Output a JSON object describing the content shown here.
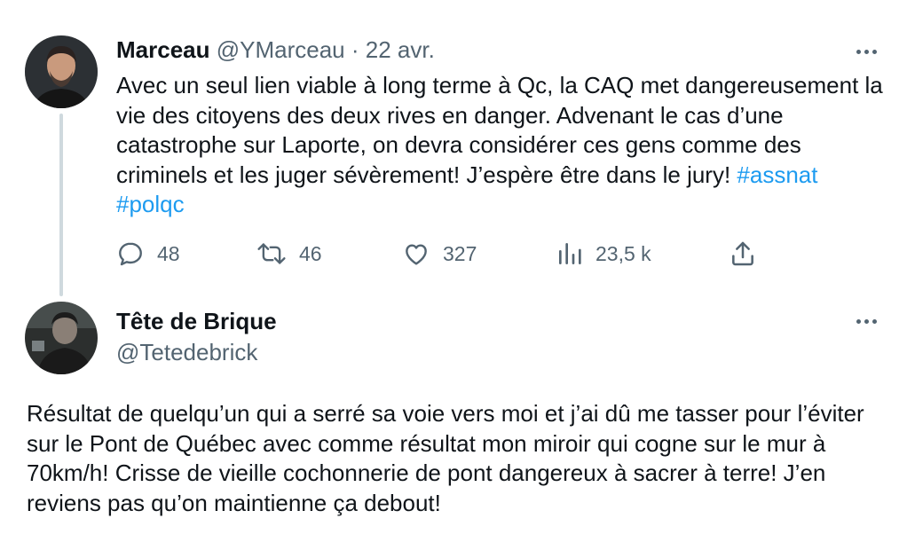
{
  "tweets": [
    {
      "display_name": "Marceau",
      "handle": "@YMarceau",
      "separator": "·",
      "date": "22 avr.",
      "text": "Avec un seul lien viable à long terme à Qc, la CAQ met dangereusement la vie des citoyens des deux rives en danger. Advenant le cas d’une catastrophe sur Laporte, on devra considérer ces gens comme des criminels et les juger sévèrement! J’espère être dans le jury! ",
      "hashtags": [
        "#assnat",
        "#polqc"
      ],
      "stats": {
        "replies": "48",
        "retweets": "46",
        "likes": "327",
        "views": "23,5 k"
      }
    },
    {
      "display_name": "Tête de Brique",
      "handle": "@Tetedebrick",
      "text": "Résultat de quelqu’un qui a serré sa voie vers moi et j’ai dû me tasser pour l’éviter sur le Pont de Québec avec comme résultat mon miroir qui cogne sur le mur à 70km/h! Crisse de vieille cochonnerie de pont dangereux à sacrer à terre! J’en reviens pas qu’on maintienne ça debout!"
    }
  ],
  "icons": {
    "reply": "reply-icon",
    "retweet": "retweet-icon",
    "like": "heart-icon",
    "views": "views-icon",
    "share": "share-icon",
    "more": "more-options-icon"
  },
  "colors": {
    "text": "#0f1419",
    "muted": "#536471",
    "link": "#1d9bf0",
    "thread_line": "#cfd9de"
  }
}
